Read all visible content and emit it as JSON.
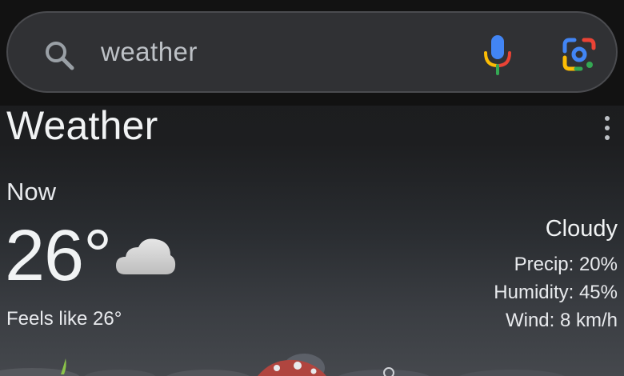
{
  "search": {
    "query": "weather",
    "search_icon": "search-icon",
    "mic_icon": "mic-icon",
    "lens_icon": "google-lens-icon"
  },
  "card": {
    "title": "Weather",
    "more_icon": "more-vert-icon"
  },
  "current": {
    "label": "Now",
    "temperature": "26°",
    "condition_icon": "cloud-icon",
    "feels_like": "Feels like 26°",
    "condition": "Cloudy",
    "precip": "Precip: 20%",
    "humidity": "Humidity: 45%",
    "wind": "Wind: 8 km/h"
  },
  "colors": {
    "background": "#1b1b1c",
    "search_bar": "#303134",
    "mic_blue": "#4285f4",
    "mic_red": "#ea4335",
    "mic_yellow": "#fbbc05",
    "mic_green": "#34a853"
  }
}
